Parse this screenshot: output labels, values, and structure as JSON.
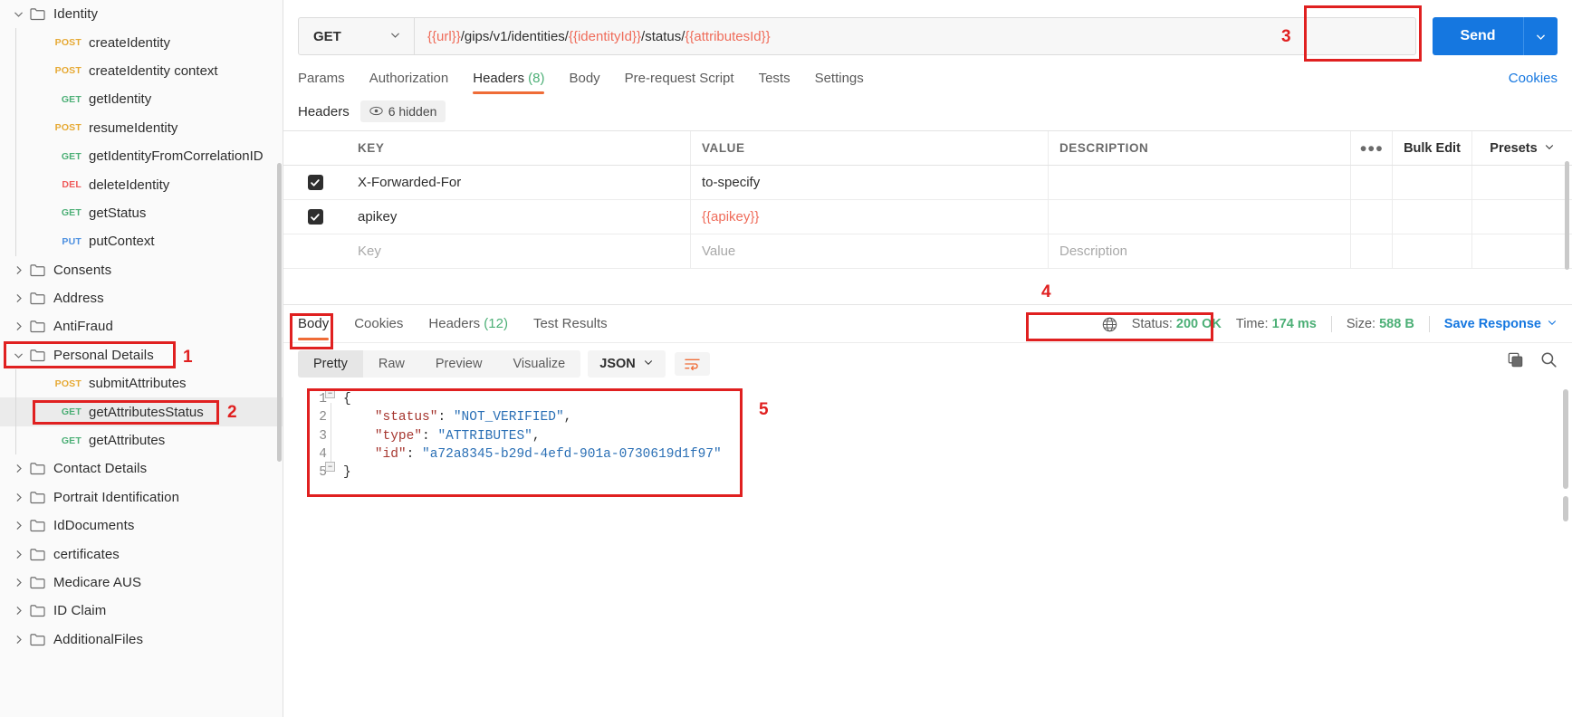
{
  "sidebar": {
    "tree": [
      {
        "kind": "folder",
        "label": "Identity",
        "expanded": true,
        "depth": 0
      },
      {
        "kind": "request",
        "method": "POST",
        "label": "createIdentity",
        "depth": 1
      },
      {
        "kind": "request",
        "method": "POST",
        "label": "createIdentity context",
        "depth": 1
      },
      {
        "kind": "request",
        "method": "GET",
        "label": "getIdentity",
        "depth": 1
      },
      {
        "kind": "request",
        "method": "POST",
        "label": "resumeIdentity",
        "depth": 1
      },
      {
        "kind": "request",
        "method": "GET",
        "label": "getIdentityFromCorrelationID",
        "depth": 1
      },
      {
        "kind": "request",
        "method": "DEL",
        "label": "deleteIdentity",
        "depth": 1
      },
      {
        "kind": "request",
        "method": "GET",
        "label": "getStatus",
        "depth": 1
      },
      {
        "kind": "request",
        "method": "PUT",
        "label": "putContext",
        "depth": 1
      },
      {
        "kind": "folder",
        "label": "Consents",
        "expanded": false,
        "depth": 0
      },
      {
        "kind": "folder",
        "label": "Address",
        "expanded": false,
        "depth": 0
      },
      {
        "kind": "folder",
        "label": "AntiFraud",
        "expanded": false,
        "depth": 0
      },
      {
        "kind": "folder",
        "label": "Personal Details",
        "expanded": true,
        "depth": 0,
        "annotated": true
      },
      {
        "kind": "request",
        "method": "POST",
        "label": "submitAttributes",
        "depth": 1
      },
      {
        "kind": "request",
        "method": "GET",
        "label": "getAttributesStatus",
        "depth": 1,
        "selected": true,
        "annotated": true
      },
      {
        "kind": "request",
        "method": "GET",
        "label": "getAttributes",
        "depth": 1
      },
      {
        "kind": "folder",
        "label": "Contact Details",
        "expanded": false,
        "depth": 0
      },
      {
        "kind": "folder",
        "label": "Portrait Identification",
        "expanded": false,
        "depth": 0
      },
      {
        "kind": "folder",
        "label": "IdDocuments",
        "expanded": false,
        "depth": 0
      },
      {
        "kind": "folder",
        "label": "certificates",
        "expanded": false,
        "depth": 0
      },
      {
        "kind": "folder",
        "label": "Medicare AUS",
        "expanded": false,
        "depth": 0
      },
      {
        "kind": "folder",
        "label": "ID Claim",
        "expanded": false,
        "depth": 0
      },
      {
        "kind": "folder",
        "label": "AdditionalFiles",
        "expanded": false,
        "depth": 0
      }
    ]
  },
  "request": {
    "method": "GET",
    "url_parts": [
      {
        "text": "{{url}}",
        "variable": true
      },
      {
        "text": "/gips/v1/identities/",
        "variable": false
      },
      {
        "text": "{{identityId}}",
        "variable": true
      },
      {
        "text": "/status/",
        "variable": false
      },
      {
        "text": "{{attributesId}}",
        "variable": true
      }
    ],
    "send_label": "Send",
    "cookies_label": "Cookies",
    "tabs": [
      {
        "label": "Params",
        "active": false
      },
      {
        "label": "Authorization",
        "active": false
      },
      {
        "label": "Headers",
        "count": "(8)",
        "active": true
      },
      {
        "label": "Body",
        "active": false
      },
      {
        "label": "Pre-request Script",
        "active": false
      },
      {
        "label": "Tests",
        "active": false
      },
      {
        "label": "Settings",
        "active": false
      }
    ],
    "headers_panel": {
      "title": "Headers",
      "hidden_pill": "6 hidden",
      "columns": [
        "KEY",
        "VALUE",
        "DESCRIPTION"
      ],
      "dots": "●●●",
      "bulk_edit": "Bulk Edit",
      "presets": "Presets",
      "rows": [
        {
          "checked": true,
          "key": "X-Forwarded-For",
          "value": "to-specify",
          "value_is_variable": false,
          "description": ""
        },
        {
          "checked": true,
          "key": "apikey",
          "value": "{{apikey}}",
          "value_is_variable": true,
          "description": ""
        }
      ],
      "empty_row": {
        "key": "Key",
        "value": "Value",
        "description": "Description"
      }
    }
  },
  "response": {
    "tabs": [
      {
        "label": "Body",
        "active": true
      },
      {
        "label": "Cookies",
        "active": false
      },
      {
        "label": "Headers",
        "count": "(12)",
        "active": false
      },
      {
        "label": "Test Results",
        "active": false
      }
    ],
    "meta": {
      "status_label": "Status:",
      "status_value": "200 OK",
      "time_label": "Time:",
      "time_value": "174 ms",
      "size_label": "Size:",
      "size_value": "588 B",
      "save_response": "Save Response"
    },
    "view_modes": [
      {
        "label": "Pretty",
        "active": true
      },
      {
        "label": "Raw",
        "active": false
      },
      {
        "label": "Preview",
        "active": false
      },
      {
        "label": "Visualize",
        "active": false
      }
    ],
    "format": "JSON",
    "body_lines": [
      {
        "num": "1",
        "tokens": [
          {
            "t": "{",
            "c": "p"
          }
        ]
      },
      {
        "num": "2",
        "tokens": [
          {
            "t": "    ",
            "c": "p"
          },
          {
            "t": "\"status\"",
            "c": "k"
          },
          {
            "t": ": ",
            "c": "p"
          },
          {
            "t": "\"NOT_VERIFIED\"",
            "c": "s"
          },
          {
            "t": ",",
            "c": "p"
          }
        ]
      },
      {
        "num": "3",
        "tokens": [
          {
            "t": "    ",
            "c": "p"
          },
          {
            "t": "\"type\"",
            "c": "k"
          },
          {
            "t": ": ",
            "c": "p"
          },
          {
            "t": "\"ATTRIBUTES\"",
            "c": "s"
          },
          {
            "t": ",",
            "c": "p"
          }
        ]
      },
      {
        "num": "4",
        "tokens": [
          {
            "t": "    ",
            "c": "p"
          },
          {
            "t": "\"id\"",
            "c": "k"
          },
          {
            "t": ": ",
            "c": "p"
          },
          {
            "t": "\"a72a8345-b29d-4efd-901a-0730619d1f97\"",
            "c": "s"
          }
        ]
      },
      {
        "num": "5",
        "tokens": [
          {
            "t": "}",
            "c": "p"
          }
        ]
      }
    ],
    "body_json": {
      "status": "NOT_VERIFIED",
      "type": "ATTRIBUTES",
      "id": "a72a8345-b29d-4efd-901a-0730619d1f97"
    }
  },
  "annotations": [
    {
      "number": "1",
      "target": "personal-details-folder"
    },
    {
      "number": "2",
      "target": "get-attributes-status-request"
    },
    {
      "number": "3",
      "target": "send-button"
    },
    {
      "number": "4",
      "target": "response-status-meta"
    },
    {
      "number": "5",
      "target": "response-body-code"
    }
  ],
  "colors": {
    "accent_orange": "#ef6c37",
    "send_blue": "#1577e0",
    "status_green": "#4caf76",
    "variable_red": "#ef6c5a",
    "annotation_red": "#e02020"
  }
}
